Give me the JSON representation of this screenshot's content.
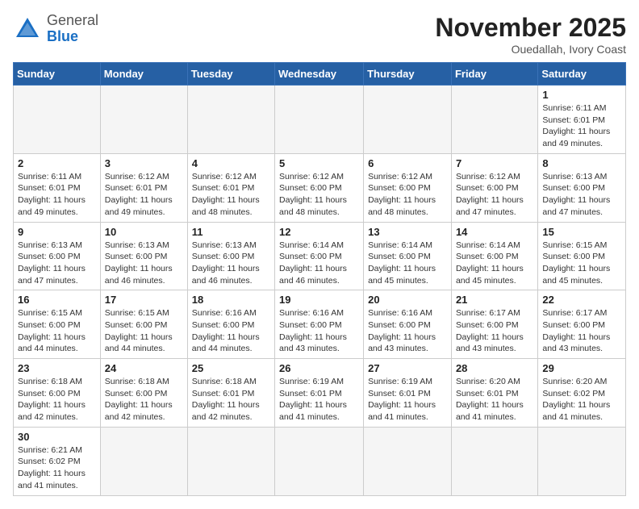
{
  "logo": {
    "general": "General",
    "blue": "Blue"
  },
  "header": {
    "month": "November 2025",
    "location": "Ouedallah, Ivory Coast"
  },
  "weekdays": [
    "Sunday",
    "Monday",
    "Tuesday",
    "Wednesday",
    "Thursday",
    "Friday",
    "Saturday"
  ],
  "days": {
    "1": {
      "sunrise": "6:11 AM",
      "sunset": "6:01 PM",
      "daylight": "11 hours and 49 minutes."
    },
    "2": {
      "sunrise": "6:11 AM",
      "sunset": "6:01 PM",
      "daylight": "11 hours and 49 minutes."
    },
    "3": {
      "sunrise": "6:12 AM",
      "sunset": "6:01 PM",
      "daylight": "11 hours and 49 minutes."
    },
    "4": {
      "sunrise": "6:12 AM",
      "sunset": "6:01 PM",
      "daylight": "11 hours and 48 minutes."
    },
    "5": {
      "sunrise": "6:12 AM",
      "sunset": "6:00 PM",
      "daylight": "11 hours and 48 minutes."
    },
    "6": {
      "sunrise": "6:12 AM",
      "sunset": "6:00 PM",
      "daylight": "11 hours and 48 minutes."
    },
    "7": {
      "sunrise": "6:12 AM",
      "sunset": "6:00 PM",
      "daylight": "11 hours and 47 minutes."
    },
    "8": {
      "sunrise": "6:13 AM",
      "sunset": "6:00 PM",
      "daylight": "11 hours and 47 minutes."
    },
    "9": {
      "sunrise": "6:13 AM",
      "sunset": "6:00 PM",
      "daylight": "11 hours and 47 minutes."
    },
    "10": {
      "sunrise": "6:13 AM",
      "sunset": "6:00 PM",
      "daylight": "11 hours and 46 minutes."
    },
    "11": {
      "sunrise": "6:13 AM",
      "sunset": "6:00 PM",
      "daylight": "11 hours and 46 minutes."
    },
    "12": {
      "sunrise": "6:14 AM",
      "sunset": "6:00 PM",
      "daylight": "11 hours and 46 minutes."
    },
    "13": {
      "sunrise": "6:14 AM",
      "sunset": "6:00 PM",
      "daylight": "11 hours and 45 minutes."
    },
    "14": {
      "sunrise": "6:14 AM",
      "sunset": "6:00 PM",
      "daylight": "11 hours and 45 minutes."
    },
    "15": {
      "sunrise": "6:15 AM",
      "sunset": "6:00 PM",
      "daylight": "11 hours and 45 minutes."
    },
    "16": {
      "sunrise": "6:15 AM",
      "sunset": "6:00 PM",
      "daylight": "11 hours and 44 minutes."
    },
    "17": {
      "sunrise": "6:15 AM",
      "sunset": "6:00 PM",
      "daylight": "11 hours and 44 minutes."
    },
    "18": {
      "sunrise": "6:16 AM",
      "sunset": "6:00 PM",
      "daylight": "11 hours and 44 minutes."
    },
    "19": {
      "sunrise": "6:16 AM",
      "sunset": "6:00 PM",
      "daylight": "11 hours and 43 minutes."
    },
    "20": {
      "sunrise": "6:16 AM",
      "sunset": "6:00 PM",
      "daylight": "11 hours and 43 minutes."
    },
    "21": {
      "sunrise": "6:17 AM",
      "sunset": "6:00 PM",
      "daylight": "11 hours and 43 minutes."
    },
    "22": {
      "sunrise": "6:17 AM",
      "sunset": "6:00 PM",
      "daylight": "11 hours and 43 minutes."
    },
    "23": {
      "sunrise": "6:18 AM",
      "sunset": "6:00 PM",
      "daylight": "11 hours and 42 minutes."
    },
    "24": {
      "sunrise": "6:18 AM",
      "sunset": "6:00 PM",
      "daylight": "11 hours and 42 minutes."
    },
    "25": {
      "sunrise": "6:18 AM",
      "sunset": "6:01 PM",
      "daylight": "11 hours and 42 minutes."
    },
    "26": {
      "sunrise": "6:19 AM",
      "sunset": "6:01 PM",
      "daylight": "11 hours and 41 minutes."
    },
    "27": {
      "sunrise": "6:19 AM",
      "sunset": "6:01 PM",
      "daylight": "11 hours and 41 minutes."
    },
    "28": {
      "sunrise": "6:20 AM",
      "sunset": "6:01 PM",
      "daylight": "11 hours and 41 minutes."
    },
    "29": {
      "sunrise": "6:20 AM",
      "sunset": "6:02 PM",
      "daylight": "11 hours and 41 minutes."
    },
    "30": {
      "sunrise": "6:21 AM",
      "sunset": "6:02 PM",
      "daylight": "11 hours and 41 minutes."
    }
  },
  "labels": {
    "sunrise": "Sunrise:",
    "sunset": "Sunset:",
    "daylight": "Daylight:"
  }
}
